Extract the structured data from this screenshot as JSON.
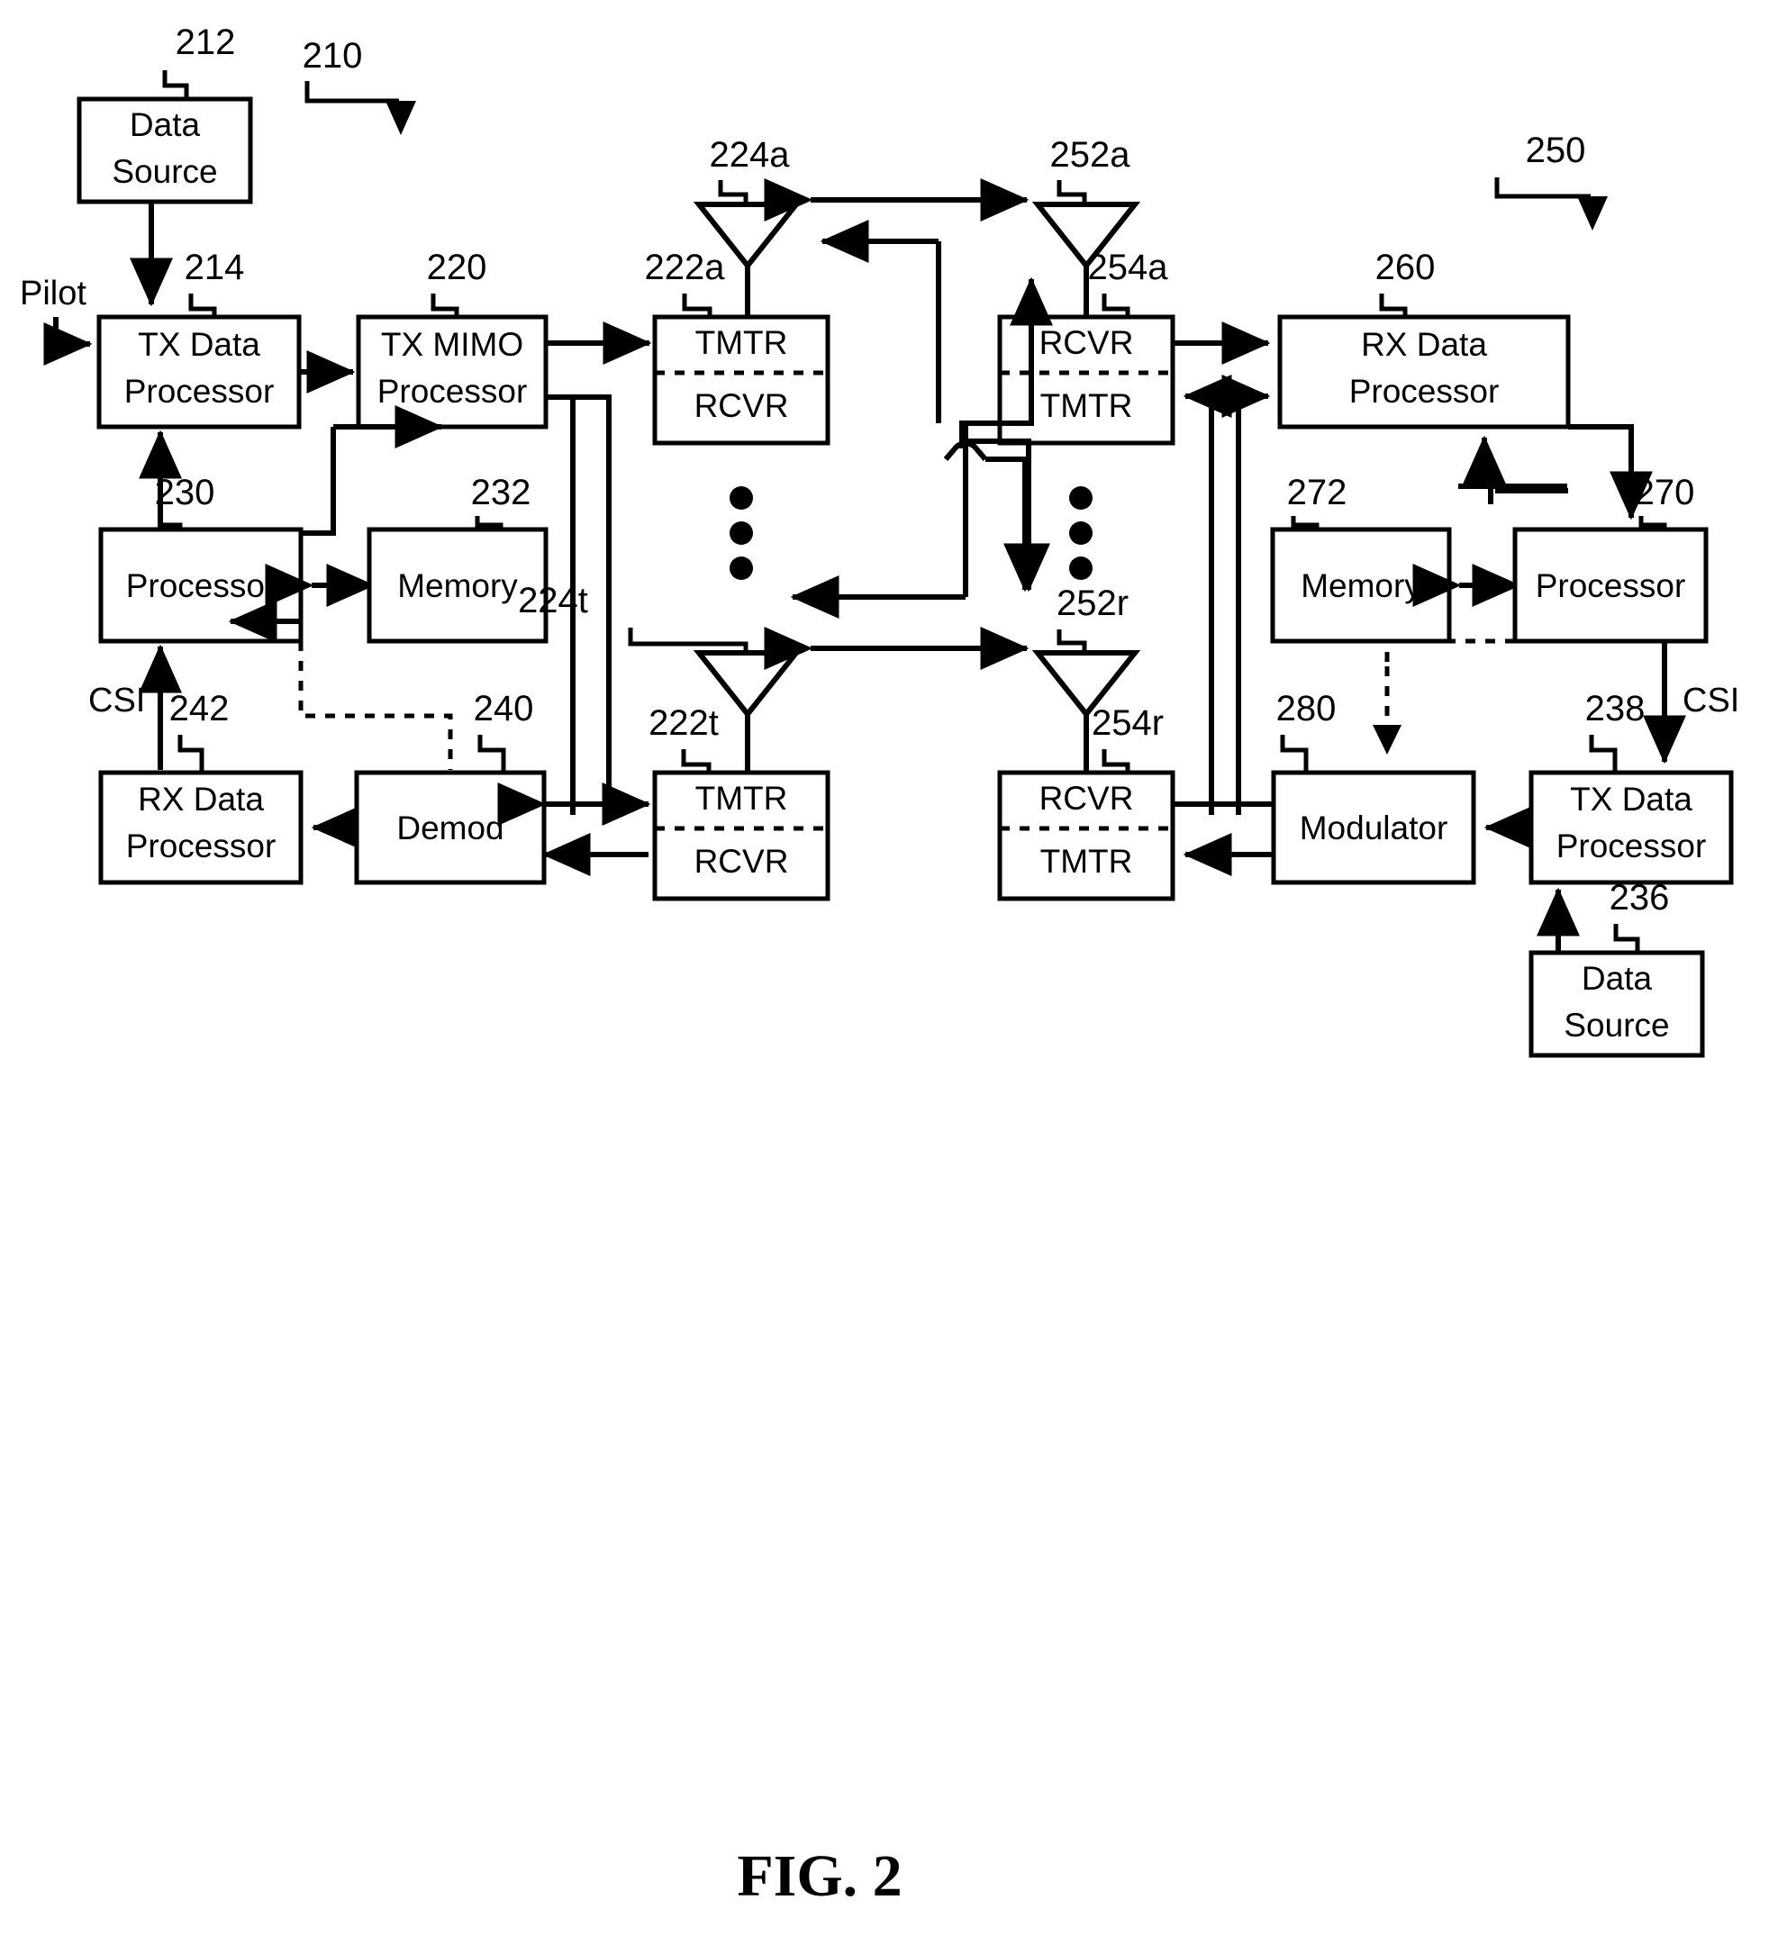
{
  "figure": {
    "caption": "FIG. 2",
    "system_ref_left": "210",
    "system_ref_right": "250"
  },
  "signals": {
    "pilot": "Pilot",
    "csi_left": "CSI",
    "csi_right": "CSI"
  },
  "blocks": [
    {
      "id": "data_source_tx",
      "label_lines": [
        "Data",
        "Source"
      ],
      "ref": "212"
    },
    {
      "id": "tx_data_proc",
      "label_lines": [
        "TX Data",
        "Processor"
      ],
      "ref": "214"
    },
    {
      "id": "tx_mimo_proc",
      "label_lines": [
        "TX MIMO",
        "Processor"
      ],
      "ref": "220"
    },
    {
      "id": "tmtr_rcvr_a",
      "label_lines": [
        "TMTR",
        "RCVR"
      ],
      "ref": "222a"
    },
    {
      "id": "tmtr_rcvr_t",
      "label_lines": [
        "TMTR",
        "RCVR"
      ],
      "ref": "222t"
    },
    {
      "id": "processor_left",
      "label_lines": [
        "Processor"
      ],
      "ref": "230"
    },
    {
      "id": "memory_left",
      "label_lines": [
        "Memory"
      ],
      "ref": "232"
    },
    {
      "id": "rx_data_proc_left",
      "label_lines": [
        "RX Data",
        "Processor"
      ],
      "ref": "242"
    },
    {
      "id": "demod_left",
      "label_lines": [
        "Demod"
      ],
      "ref": "240"
    },
    {
      "id": "rcvr_tmtr_a",
      "label_lines": [
        "RCVR",
        "TMTR"
      ],
      "ref": "254a"
    },
    {
      "id": "rcvr_tmtr_r",
      "label_lines": [
        "RCVR",
        "TMTR"
      ],
      "ref": "254r"
    },
    {
      "id": "rx_data_proc_right",
      "label_lines": [
        "RX Data",
        "Processor"
      ],
      "ref": "260"
    },
    {
      "id": "memory_right",
      "label_lines": [
        "Memory"
      ],
      "ref": "272"
    },
    {
      "id": "processor_right",
      "label_lines": [
        "Processor"
      ],
      "ref": "270"
    },
    {
      "id": "modulator",
      "label_lines": [
        "Modulator"
      ],
      "ref": "280"
    },
    {
      "id": "tx_data_proc_right",
      "label_lines": [
        "TX Data",
        "Processor"
      ],
      "ref": "238"
    },
    {
      "id": "data_source_rx",
      "label_lines": [
        "Data",
        "Source"
      ],
      "ref": "236"
    }
  ],
  "antennas": [
    {
      "id": "ant_224a",
      "ref": "224a"
    },
    {
      "id": "ant_224t",
      "ref": "224t"
    },
    {
      "id": "ant_252a",
      "ref": "252a"
    },
    {
      "id": "ant_252r",
      "ref": "252r"
    }
  ],
  "text": {
    "data": "Data",
    "source": "Source",
    "tx_data": "TX Data",
    "processor": "Processor",
    "tx_mimo": "TX MIMO",
    "tmtr": "TMTR",
    "rcvr": "RCVR",
    "memory": "Memory",
    "rx_data": "RX Data",
    "demod": "Demod",
    "modulator": "Modulator"
  },
  "refs": {
    "r210": "210",
    "r212": "212",
    "r214": "214",
    "r220": "220",
    "r222a": "222a",
    "r222t": "222t",
    "r224a": "224a",
    "r224t": "224t",
    "r230": "230",
    "r232": "232",
    "r236": "236",
    "r238": "238",
    "r240": "240",
    "r242": "242",
    "r250": "250",
    "r252a": "252a",
    "r252r": "252r",
    "r254a": "254a",
    "r254r": "254r",
    "r260": "260",
    "r270": "270",
    "r272": "272",
    "r280": "280"
  },
  "colors": {
    "ink": "#000000",
    "paper": "#ffffff"
  }
}
